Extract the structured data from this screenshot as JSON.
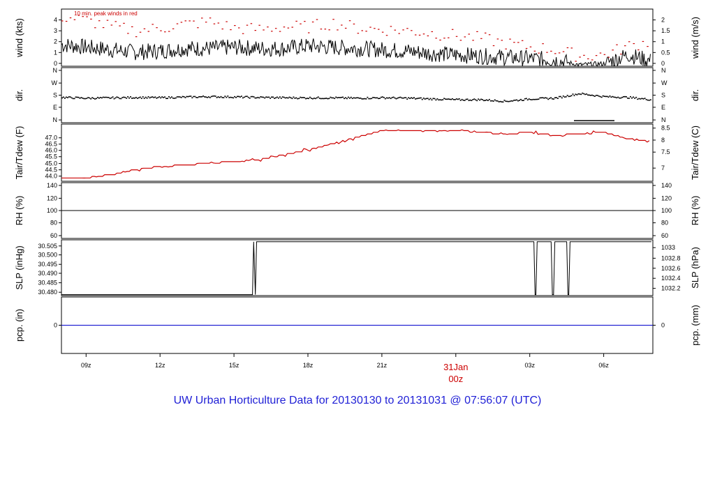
{
  "title": "UW Urban Horticulture Data for 20130130  to  20131031 @ 07:56:07  (UTC)",
  "note": "10 min. peak winds in red",
  "date_label": {
    "day": "31Jan",
    "hour": "00z",
    "color": "#cc0000"
  },
  "colors": {
    "line": "#000000",
    "peak": "#cc0000",
    "temp": "#cc0000",
    "precip": "#0000cc",
    "title": "#1f1fd6"
  },
  "chart_data": [
    {
      "type": "line",
      "panel": "wind",
      "ylabel": "wind (kts)",
      "ylabel_right": "wind (m/s)",
      "ylim": [
        0,
        4.5
      ],
      "ticks_left": [
        "0",
        "1",
        "2",
        "3",
        "4"
      ],
      "ticks_right": [
        "0",
        "0.5",
        "1",
        "1.5",
        "2"
      ],
      "series": [
        {
          "name": "wind speed",
          "x": [
            "08:00",
            "09:00",
            "10:00",
            "11:00",
            "12:00",
            "13:00",
            "14:00",
            "15:00",
            "16:00",
            "17:00",
            "18:00",
            "19:00",
            "20:00",
            "21:00",
            "22:00",
            "23:00",
            "00:00",
            "01:00",
            "02:00",
            "03:00",
            "04:00",
            "05:00",
            "06:00",
            "07:00",
            "07:56"
          ],
          "values": [
            1.7,
            1.5,
            1.3,
            1.1,
            1.2,
            1.4,
            1.4,
            1.5,
            1.4,
            1.4,
            1.6,
            1.5,
            1.4,
            1.3,
            1.2,
            1.0,
            0.9,
            0.8,
            0.7,
            0.6,
            0.5,
            0.1,
            0.2,
            0.9,
            0.4
          ]
        },
        {
          "name": "10 min. peak winds",
          "x": [
            "08:00",
            "09:00",
            "10:00",
            "11:00",
            "12:00",
            "13:00",
            "14:00",
            "15:00",
            "16:00",
            "17:00",
            "18:00",
            "19:00",
            "20:00",
            "21:00",
            "22:00",
            "23:00",
            "00:00",
            "01:00",
            "02:00",
            "03:00",
            "04:00",
            "05:00",
            "06:00",
            "07:00",
            "07:56"
          ],
          "values": [
            3.9,
            3.6,
            3.1,
            2.8,
            3.0,
            3.3,
            3.5,
            3.0,
            2.9,
            3.1,
            3.1,
            3.4,
            3.0,
            2.9,
            2.8,
            2.6,
            2.4,
            2.2,
            1.8,
            1.5,
            1.3,
            0.8,
            0.9,
            1.6,
            2.0
          ]
        }
      ]
    },
    {
      "type": "scatter",
      "panel": "direction",
      "ylabel": "dir.",
      "ylabel_right": "dir.",
      "ticks_left": [
        "N",
        "E",
        "S",
        "W",
        "N"
      ],
      "ticks_right": [
        "N",
        "E",
        "S",
        "W",
        "N"
      ],
      "ylim": [
        0,
        360
      ],
      "series": [
        {
          "name": "wind direction",
          "x": [
            "08:00",
            "09:00",
            "10:00",
            "11:00",
            "12:00",
            "13:00",
            "14:00",
            "15:00",
            "16:00",
            "17:00",
            "18:00",
            "19:00",
            "20:00",
            "21:00",
            "22:00",
            "23:00",
            "00:00",
            "01:00",
            "02:00",
            "03:00",
            "04:00",
            "05:00",
            "06:00",
            "07:00",
            "07:56"
          ],
          "values": [
            165,
            160,
            162,
            165,
            163,
            167,
            170,
            168,
            165,
            163,
            162,
            162,
            160,
            163,
            160,
            155,
            150,
            150,
            140,
            155,
            160,
            190,
            170,
            165,
            150
          ]
        }
      ]
    },
    {
      "type": "line",
      "panel": "temperature",
      "ylabel": "Tair/Tdew (F)",
      "ylabel_right": "Tair/Tdew (C)",
      "ylim": [
        43.9,
        47.4
      ],
      "ticks_left": [
        "44.0",
        "44.5",
        "45.0",
        "45.5",
        "46.0",
        "46.5",
        "47.0"
      ],
      "ticks_right": [
        "7",
        "7.5",
        "8",
        "8.5"
      ],
      "series": [
        {
          "name": "air temperature",
          "x": [
            "08:00",
            "09:00",
            "10:00",
            "11:00",
            "12:00",
            "13:00",
            "14:00",
            "15:00",
            "16:00",
            "17:00",
            "18:00",
            "19:00",
            "20:00",
            "21:00",
            "22:00",
            "23:00",
            "00:00",
            "01:00",
            "02:00",
            "03:00",
            "04:00",
            "05:00",
            "06:00",
            "07:00",
            "07:56"
          ],
          "values": [
            44.1,
            44.1,
            44.3,
            44.6,
            44.8,
            44.9,
            45.0,
            45.1,
            45.2,
            45.5,
            45.8,
            46.2,
            46.6,
            47.0,
            47.0,
            47.0,
            47.0,
            46.9,
            46.8,
            46.9,
            46.7,
            46.8,
            46.9,
            46.5,
            46.3
          ]
        }
      ]
    },
    {
      "type": "line",
      "panel": "humidity",
      "ylabel": "RH (%)",
      "ylabel_right": "RH (%)",
      "ylim": [
        60,
        140
      ],
      "ticks_left": [
        "60",
        "80",
        "100",
        "120",
        "140"
      ],
      "ticks_right": [
        "60",
        "80",
        "100",
        "120",
        "140"
      ],
      "series": [
        {
          "name": "relative humidity",
          "x": [
            "08:00",
            "07:56"
          ],
          "values": [
            100,
            100
          ]
        }
      ]
    },
    {
      "type": "line",
      "panel": "pressure",
      "ylabel": "SLP (inHg)",
      "ylabel_right": "SLP (hPa)",
      "ylim": [
        30.4775,
        30.506
      ],
      "ticks_left": [
        "30.480",
        "30.485",
        "30.490",
        "30.495",
        "30.500",
        "30.505"
      ],
      "ticks_right": [
        "1032.2",
        "1032.4",
        "1032.6",
        "1032.8",
        "1033"
      ],
      "series": [
        {
          "name": "sea level pressure",
          "x": [
            "08:00",
            "15:45",
            "15:48",
            "15:52",
            "15:55",
            "03:10",
            "03:13",
            "03:15",
            "03:18",
            "03:52",
            "03:55",
            "03:58",
            "04:01",
            "04:30",
            "04:33",
            "04:35",
            "04:38",
            "07:56"
          ],
          "values": [
            30.478,
            30.478,
            30.505,
            30.478,
            30.505,
            30.505,
            30.478,
            30.478,
            30.505,
            30.505,
            30.478,
            30.478,
            30.505,
            30.505,
            30.478,
            30.478,
            30.505,
            30.505
          ]
        }
      ]
    },
    {
      "type": "line",
      "panel": "precipitation",
      "ylabel": "pcp. (in)",
      "ylabel_right": "pcp. (mm)",
      "ylim": [
        -1,
        1
      ],
      "ticks_left": [
        "0"
      ],
      "ticks_right": [
        "0"
      ],
      "series": [
        {
          "name": "precipitation",
          "x": [
            "08:00",
            "07:56"
          ],
          "values": [
            0,
            0
          ]
        }
      ]
    }
  ],
  "x_axis": {
    "ticks": [
      "09z",
      "12z",
      "15z",
      "18z",
      "21z",
      "00z",
      "03z",
      "06z"
    ]
  }
}
